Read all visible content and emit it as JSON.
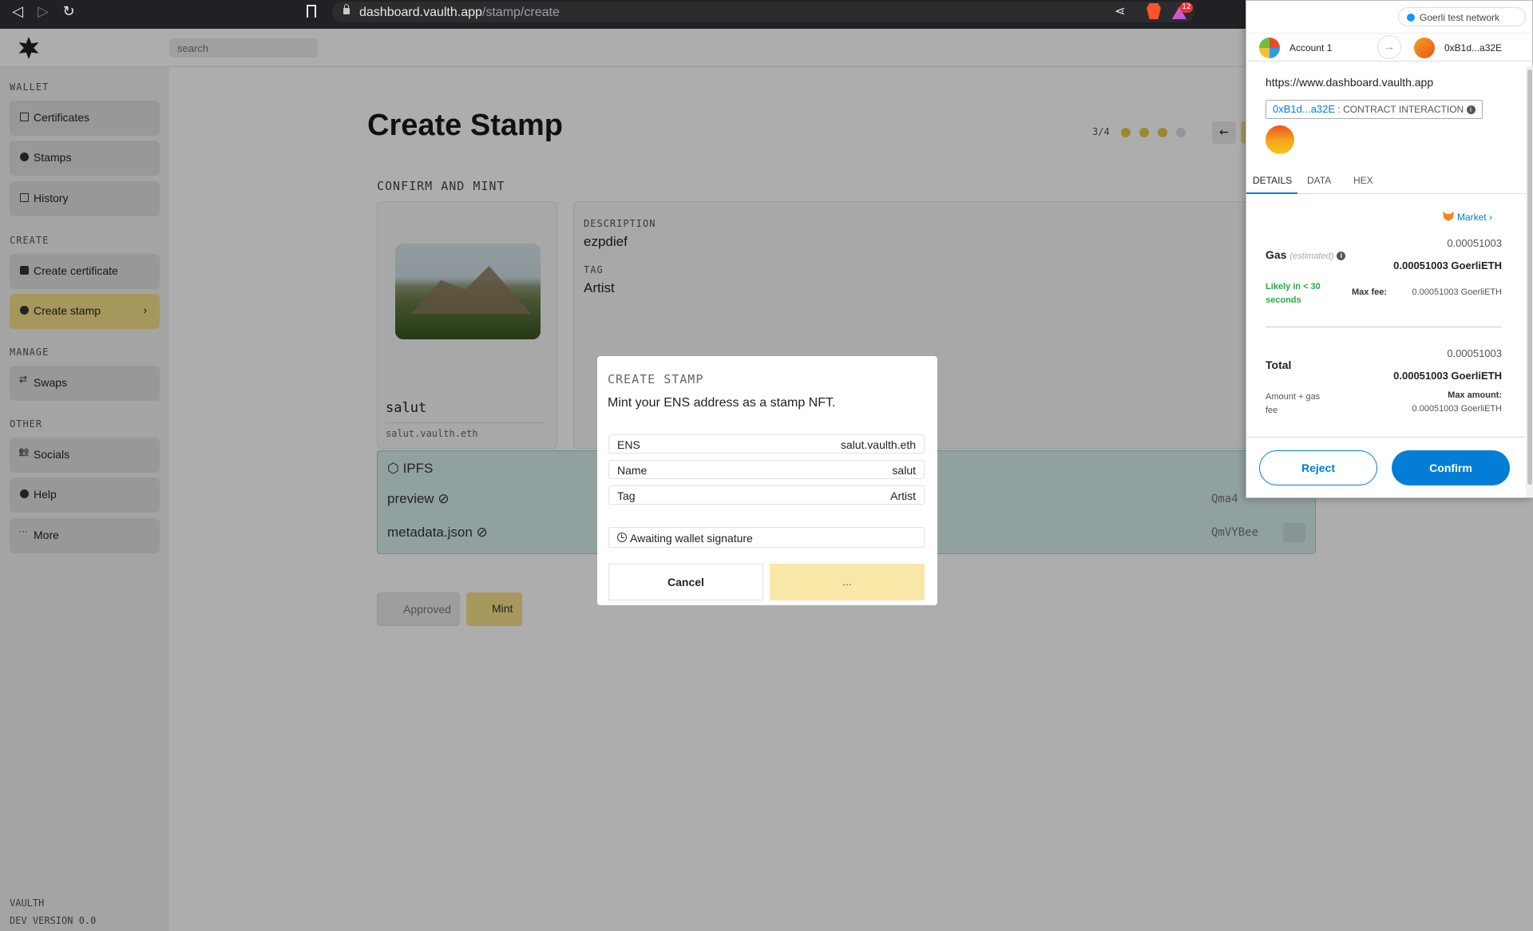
{
  "browser": {
    "url_host": "dashboard.vaulth.app",
    "url_path": "/stamp/create",
    "badge_count": "12"
  },
  "app": {
    "search_placeholder": "search",
    "sidebar": {
      "sections": {
        "wallet": "WALLET",
        "create": "CREATE",
        "manage": "MANAGE",
        "other": "OTHER"
      },
      "items": {
        "certificates": "Certificates",
        "stamps": "Stamps",
        "history": "History",
        "create_certificate": "Create certificate",
        "create_stamp": "Create stamp",
        "swaps": "Swaps",
        "socials": "Socials",
        "help": "Help",
        "more": "More"
      },
      "chevron": "›",
      "footer_name": "VAULTH",
      "footer_version": "DEV VERSION 0.0"
    },
    "main": {
      "title": "Create Stamp",
      "step": "3/4",
      "step_progress": {
        "completed": 3,
        "total": 4
      },
      "section_title": "CONFIRM AND MINT",
      "stamp": {
        "name": "salut",
        "ens": "salut.vaulth.eth"
      },
      "details": {
        "description_label": "DESCRIPTION",
        "description_value": "ezpdief",
        "tag_label": "TAG",
        "tag_value": "Artist"
      },
      "ipfs": {
        "title": "IPFS",
        "rows": [
          {
            "name": "preview",
            "hash": "Qma4"
          },
          {
            "name": "metadata.json",
            "hash": "QmVYBee"
          }
        ]
      },
      "approved_label": "Approved",
      "mint_label": "Mint"
    }
  },
  "modal": {
    "title": "CREATE STAMP",
    "subtitle": "Mint your ENS address as a stamp NFT.",
    "rows": [
      {
        "key": "ENS",
        "value": "salut.vaulth.eth"
      },
      {
        "key": "Name",
        "value": "salut"
      },
      {
        "key": "Tag",
        "value": "Artist"
      }
    ],
    "status": "Awaiting wallet signature",
    "cancel_label": "Cancel",
    "progress_label": "..."
  },
  "metamask": {
    "network": "Goerli test network",
    "from_account": "Account 1",
    "to_account": "0xB1d...a32E",
    "origin": "https://www.dashboard.vaulth.app",
    "contract_address": "0xB1d...a32E",
    "contract_label": ": CONTRACT INTERACTION",
    "tabs": [
      "DETAILS",
      "DATA",
      "HEX"
    ],
    "market_label": "Market",
    "gas": {
      "label": "Gas",
      "estimated": "(estimated)",
      "fiat_value": "0.00051003",
      "value": "0.00051003 GoerliETH",
      "speed": "Likely in < 30 seconds",
      "max_fee_label": "Max fee:",
      "max_fee_value": "0.00051003 GoerliETH"
    },
    "total": {
      "label": "Total",
      "fiat_value": "0.00051003",
      "value": "0.00051003 GoerliETH",
      "amount_gas_label": "Amount + gas fee",
      "max_amount_label": "Max amount:",
      "max_amount_value": "0.00051003 GoerliETH"
    },
    "reject_label": "Reject",
    "confirm_label": "Confirm"
  },
  "colors": {
    "accent_yellow": "#f5e08a",
    "metamask_blue": "#037dd6",
    "ipfs_teal": "#d5eeec",
    "success_green": "#28a745"
  }
}
